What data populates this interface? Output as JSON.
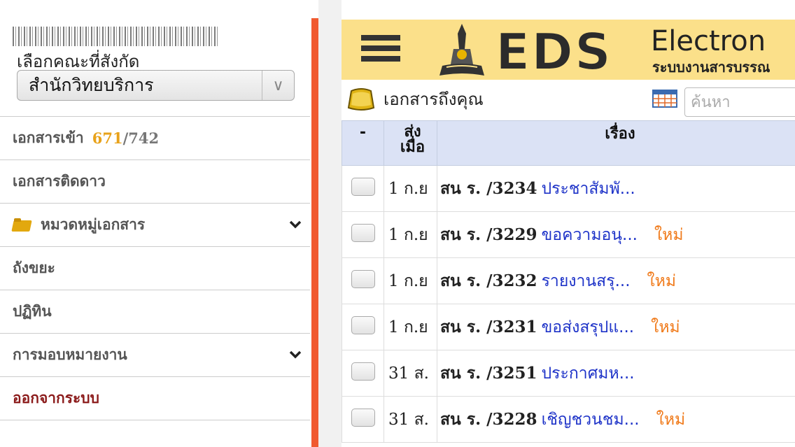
{
  "sidebar": {
    "faculty_label": "เลือกคณะที่สังกัด",
    "faculty_selected": "สำนักวิทยบริการ",
    "menu": [
      {
        "label": "เอกสารเข้า",
        "count_new": "671",
        "count_total": "/742"
      },
      {
        "label": "เอกสารติดดาว"
      },
      {
        "label": "หมวดหมู่เอกสาร"
      },
      {
        "label": "ถังขยะ"
      },
      {
        "label": "ปฏิทิน"
      },
      {
        "label": "การมอบหมายงาน"
      },
      {
        "label": "ออกจากระบบ"
      }
    ]
  },
  "header": {
    "logo_text": "EDS",
    "title": "Electron",
    "subtitle": "ระบบงานสารบรรณ"
  },
  "main": {
    "heading": "เอกสารถึงคุณ",
    "search_placeholder": "ค้นหา",
    "columns": {
      "check": "-",
      "date_line1": "ส่ง",
      "date_line2": "เมื่อ",
      "subject": "เรื่อง"
    },
    "rows": [
      {
        "date": "1 ก.ย",
        "doc_no": "สน ร. /3234",
        "title": "ประชาสัมพั...",
        "badge": ""
      },
      {
        "date": "1 ก.ย",
        "doc_no": "สน ร. /3229",
        "title": "ขอความอนุ...",
        "badge": "ใหม่"
      },
      {
        "date": "1 ก.ย",
        "doc_no": "สน ร. /3232",
        "title": "รายงานสรุ...",
        "badge": "ใหม่"
      },
      {
        "date": "1 ก.ย",
        "doc_no": "สน ร. /3231",
        "title": "ขอส่งสรุปแ...",
        "badge": "ใหม่"
      },
      {
        "date": "31 ส.",
        "doc_no": "สน ร. /3251",
        "title": "ประกาศมห...",
        "badge": ""
      },
      {
        "date": "31 ส.",
        "doc_no": "สน ร. /3228",
        "title": "เชิญชวนชม...",
        "badge": "ใหม่"
      }
    ]
  },
  "colors": {
    "accent_divider": "#f05a30",
    "header_bg": "#fbe08a",
    "count_new": "#e8a21a",
    "link_blue": "#1e33c8",
    "new_badge": "#f07a1a",
    "logout": "#8b1a1a"
  }
}
